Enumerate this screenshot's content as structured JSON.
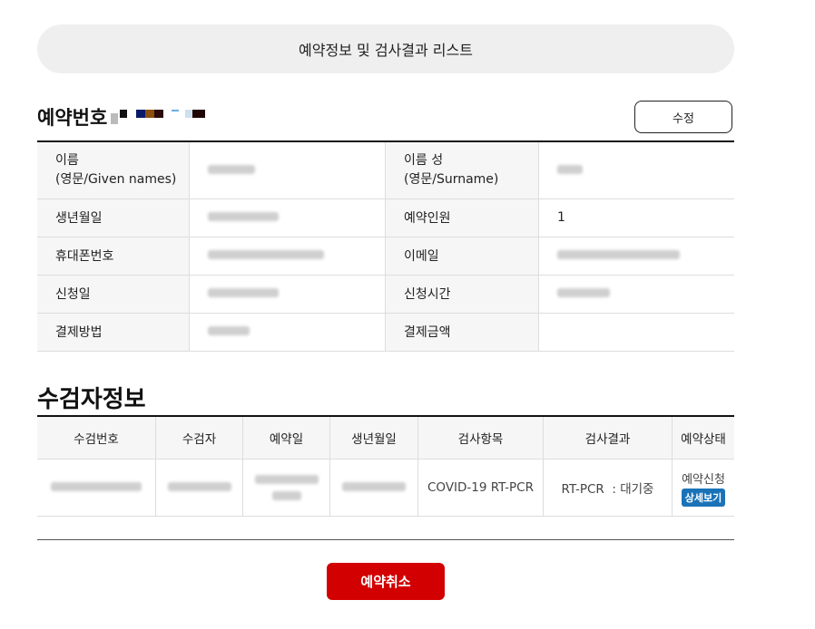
{
  "header": {
    "title": "예약정보 및 검사결과 리스트"
  },
  "reservation": {
    "title": "예약번호",
    "edit_label": "수정",
    "rows": [
      {
        "label1": "이름\n(영문/Given names)",
        "label2": "이름 성\n(영문/Surname)",
        "value2": ""
      },
      {
        "label1": "생년월일",
        "label2": "예약인원",
        "value2": "1"
      },
      {
        "label1": "휴대폰번호",
        "label2": "이메일",
        "value2": ""
      },
      {
        "label1": "신청일",
        "label2": "신청시간",
        "value2": ""
      },
      {
        "label1": "결제방법",
        "label2": "결제금액",
        "value2": ""
      }
    ]
  },
  "examinee": {
    "title": "수검자정보",
    "columns": [
      "수검번호",
      "수검자",
      "예약일",
      "생년월일",
      "검사항목",
      "검사결과",
      "예약상태"
    ],
    "row": {
      "test_item": "COVID-19 RT-PCR",
      "test_result": "RT-PCR  : 대기중",
      "status": "예약신청",
      "detail_label": "상세보기"
    }
  },
  "footer": {
    "cancel_label": "예약취소"
  },
  "colors": {
    "cancel": "#d20000",
    "detail": "#1a73b9",
    "pill": "#eeefee"
  }
}
